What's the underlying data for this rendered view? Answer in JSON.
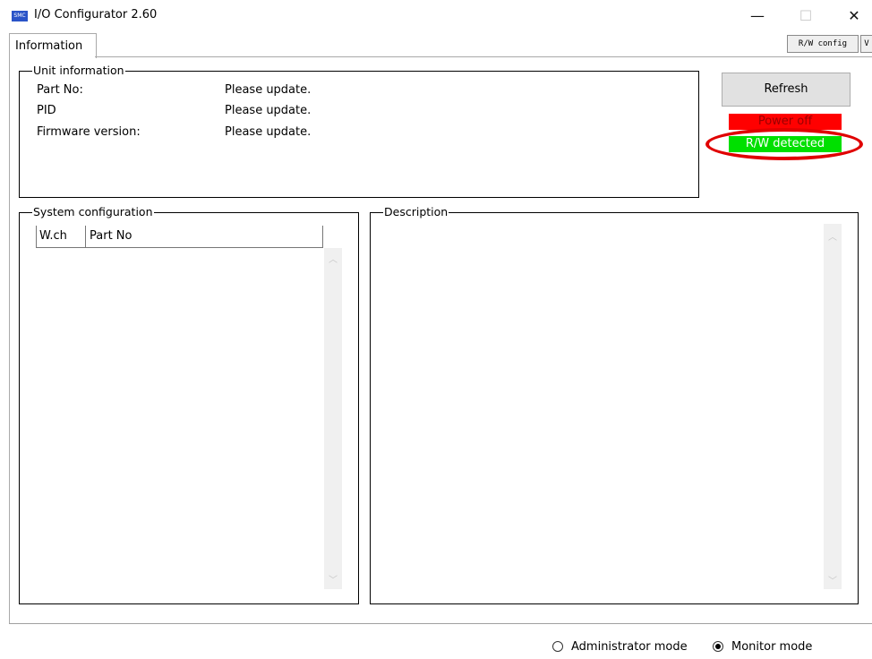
{
  "window": {
    "title": "I/O Configurator 2.60",
    "app_icon_text": "SMC",
    "minimize_glyph": "—",
    "maximize_glyph": "☐",
    "close_glyph": "✕"
  },
  "tabs": {
    "items": [
      {
        "label": "Information",
        "selected": true
      }
    ],
    "rw_config_label": "R/W config",
    "truncated_button_label": "V"
  },
  "unit_info": {
    "legend": "Unit information",
    "rows": [
      {
        "label": "Part No:",
        "value": "Please update."
      },
      {
        "label": "PID",
        "value": "Please update."
      },
      {
        "label": "Firmware version:",
        "value": "Please update."
      }
    ]
  },
  "actions": {
    "refresh_label": "Refresh"
  },
  "status": {
    "power_label": "Power off",
    "power_color": "#ff0000",
    "rw_label": "R/W detected",
    "rw_color": "#00e000",
    "highlight_color": "#e00000"
  },
  "system_config": {
    "legend": "System configuration",
    "columns": [
      "W.ch",
      "Part No"
    ],
    "rows": []
  },
  "description": {
    "legend": "Description",
    "text": ""
  },
  "mode": {
    "options": [
      {
        "label": "Administrator mode",
        "selected": false
      },
      {
        "label": "Monitor mode",
        "selected": true
      }
    ]
  }
}
